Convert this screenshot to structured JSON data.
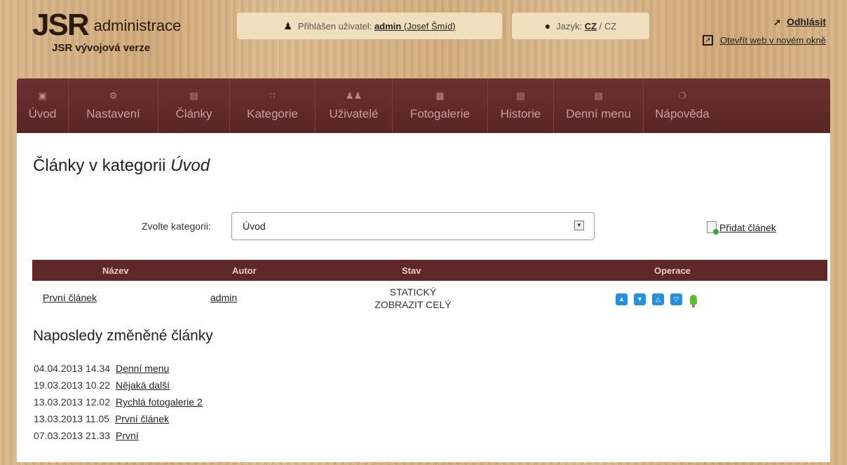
{
  "header": {
    "logo_main": "JSR",
    "logo_suffix": "administrace",
    "subtitle": "JSR vývojová verze",
    "user_prefix": "Přihlášen uživatel:",
    "user_name": "admin",
    "user_full": "(Josef Šmíd)",
    "lang_prefix": "Jazyk:",
    "lang_current": "CZ",
    "lang_sep": "/",
    "lang_other": "CZ",
    "logout_label": "Odhlásit",
    "open_web_label": "Otevřít web v novém okně",
    "icons": {
      "user": "user-icon",
      "lang": "speech-bubble-icon",
      "logout": "arrow-up-right-icon",
      "open_web": "external-link-icon"
    }
  },
  "nav": {
    "items": [
      {
        "label": "Úvod",
        "icon": "laptop-icon"
      },
      {
        "label": "Nastavení",
        "icon": "gears-icon"
      },
      {
        "label": "Články",
        "icon": "book-icon"
      },
      {
        "label": "Kategorie",
        "icon": "grid-icon"
      },
      {
        "label": "Uživatelé",
        "icon": "users-icon"
      },
      {
        "label": "Fotogalerie",
        "icon": "picture-icon"
      },
      {
        "label": "Historie",
        "icon": "book-icon"
      },
      {
        "label": "Denní menu",
        "icon": "book-icon"
      },
      {
        "label": "Nápověda",
        "icon": "lifebuoy-icon"
      }
    ]
  },
  "main": {
    "title_prefix": "Články v kategorii",
    "title_category": "Úvod",
    "category_label": "Zvolte kategorii:",
    "category_value": "Úvod",
    "add_article_label": "Přidat článek",
    "table": {
      "headers": [
        "Název",
        "Autor",
        "Stav",
        "Operace"
      ],
      "rows": [
        {
          "name": "První článek",
          "author": "admin",
          "state_line1": "STATICKÝ",
          "state_line2": "ZOBRAZIT CELÝ",
          "operations": [
            "move-up-icon",
            "move-down-icon",
            "move-top-icon",
            "move-bottom-icon",
            "lightbulb-icon"
          ]
        }
      ]
    },
    "recent_title": "Naposledy změněné články",
    "recent": [
      {
        "date": "04.04.2013 14.34",
        "title": "Denní menu"
      },
      {
        "date": "19.03.2013 10.22",
        "title": "Nějaká další"
      },
      {
        "date": "13.03.2013 12.02",
        "title": "Rychlá fotogalerie 2"
      },
      {
        "date": "13.03.2013 11.05",
        "title": "První článek"
      },
      {
        "date": "07.03.2013 21.33",
        "title": "První"
      }
    ]
  },
  "colors": {
    "nav_bg": "#5e2828",
    "table_head_bg": "#5e2828",
    "pill_bg": "#f0dfbd",
    "op_button": "#2a8fd6",
    "bulb": "#5bbf2d"
  }
}
